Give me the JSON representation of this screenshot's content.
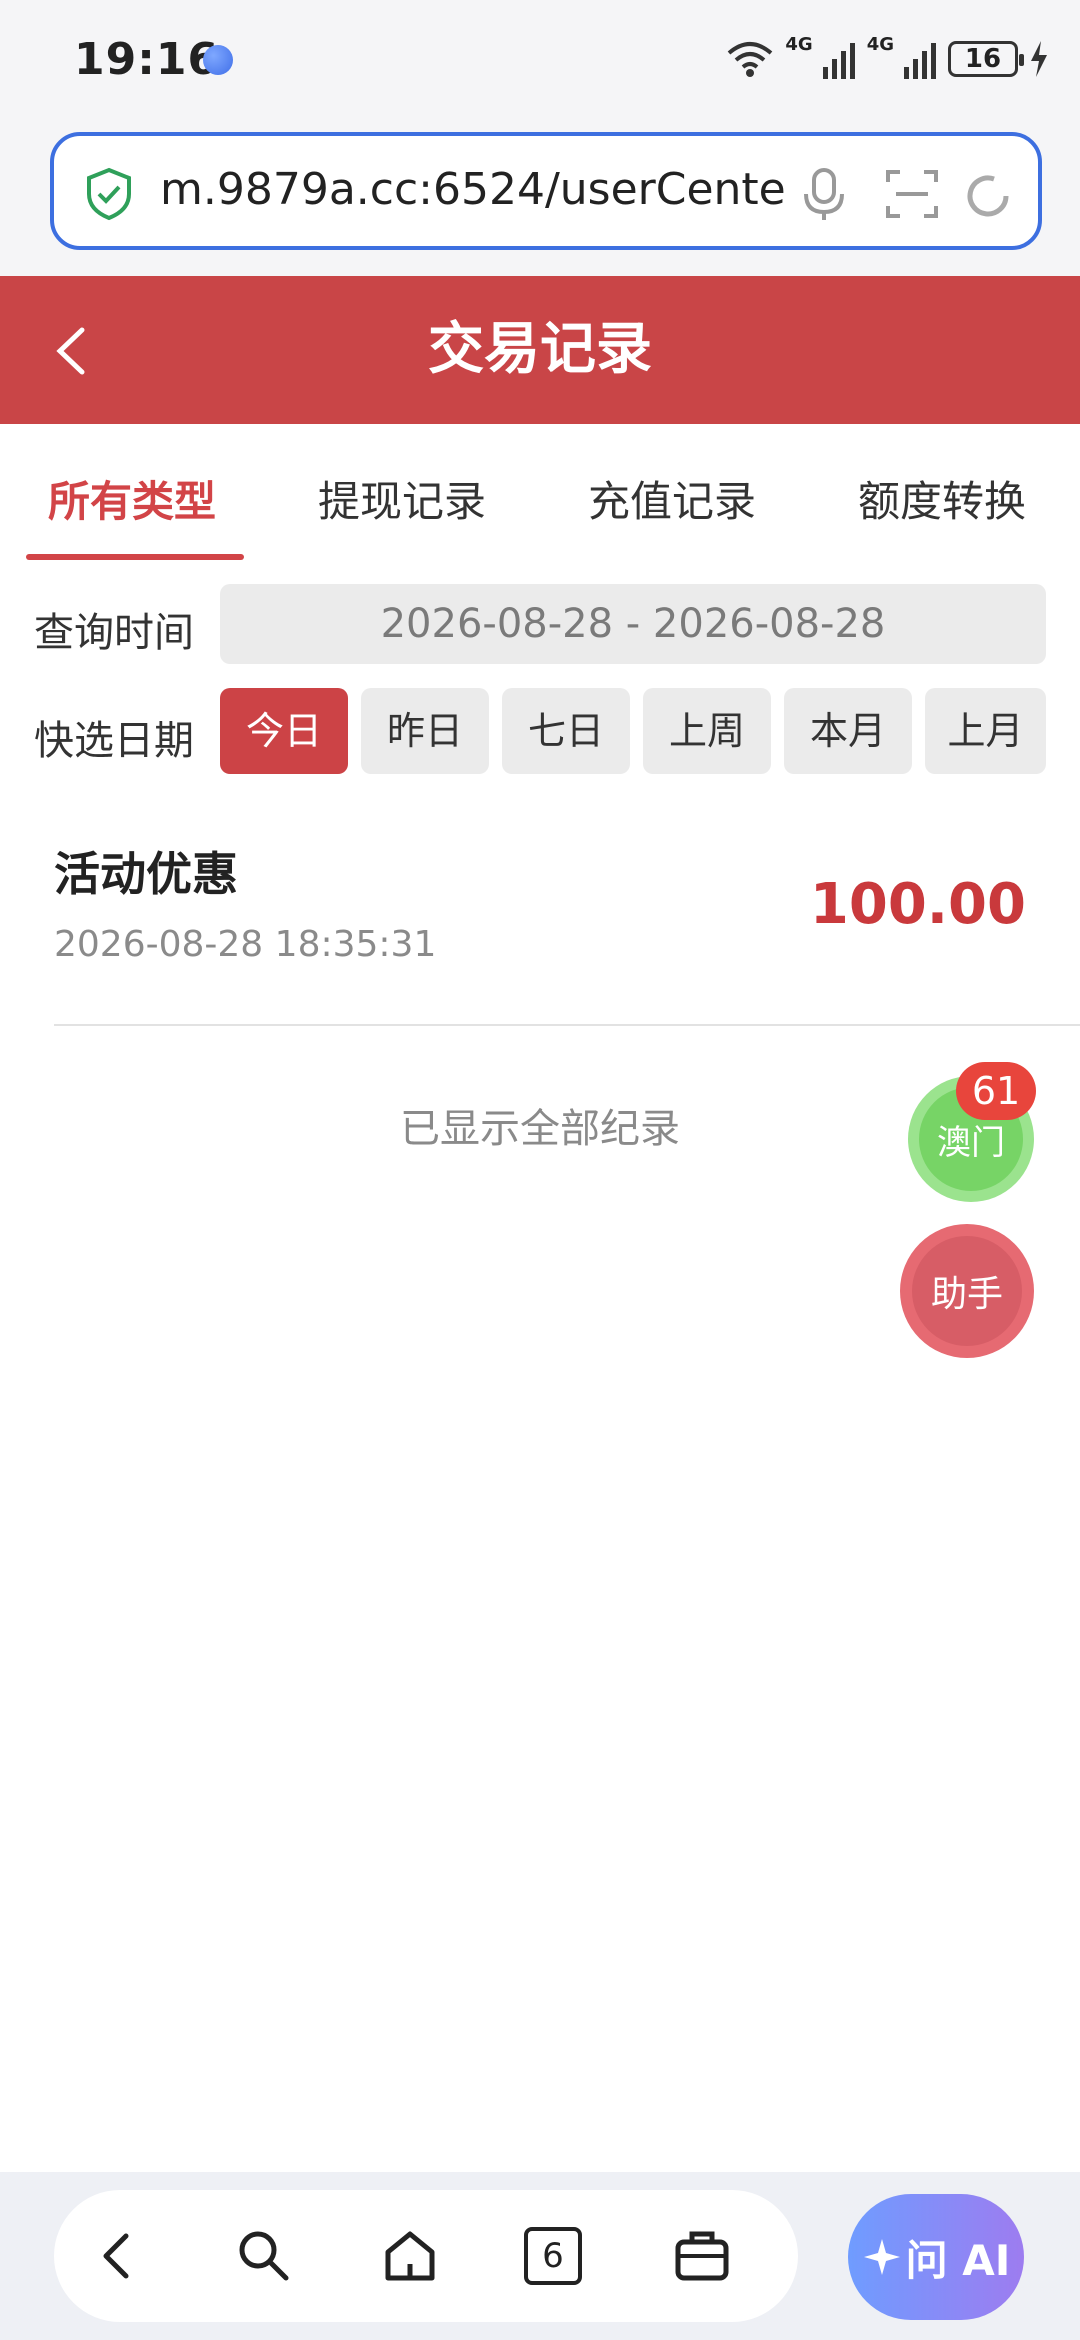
{
  "status_bar": {
    "time": "19:16",
    "network_1": "4G",
    "network_2": "4G",
    "battery": "16"
  },
  "browser": {
    "url": "m.9879a.cc:6524/userCenter"
  },
  "header": {
    "title": "交易记录"
  },
  "tabs": [
    {
      "label": "所有类型",
      "active": true
    },
    {
      "label": "提现记录",
      "active": false
    },
    {
      "label": "充值记录",
      "active": false
    },
    {
      "label": "额度转换",
      "active": false
    }
  ],
  "query": {
    "time_label": "查询时间",
    "date_range": "2026-08-28 - 2026-08-28",
    "quick_label": "快选日期",
    "quick_options": [
      "今日",
      "昨日",
      "七日",
      "上周",
      "本月",
      "上月"
    ],
    "quick_selected": "今日"
  },
  "records": [
    {
      "title": "活动优惠",
      "time": "2026-08-28 18:35:31",
      "amount": "100.00"
    }
  ],
  "end_text": "已显示全部纪录",
  "floating": {
    "green_label": "澳门",
    "green_badge": "61",
    "red_label": "助手"
  },
  "bottom_bar": {
    "tabs_count": "6",
    "ai_label": "问 AI"
  },
  "colors": {
    "header_red": "#c94547",
    "accent_red": "#d24447",
    "url_border": "#3d6fe0"
  }
}
